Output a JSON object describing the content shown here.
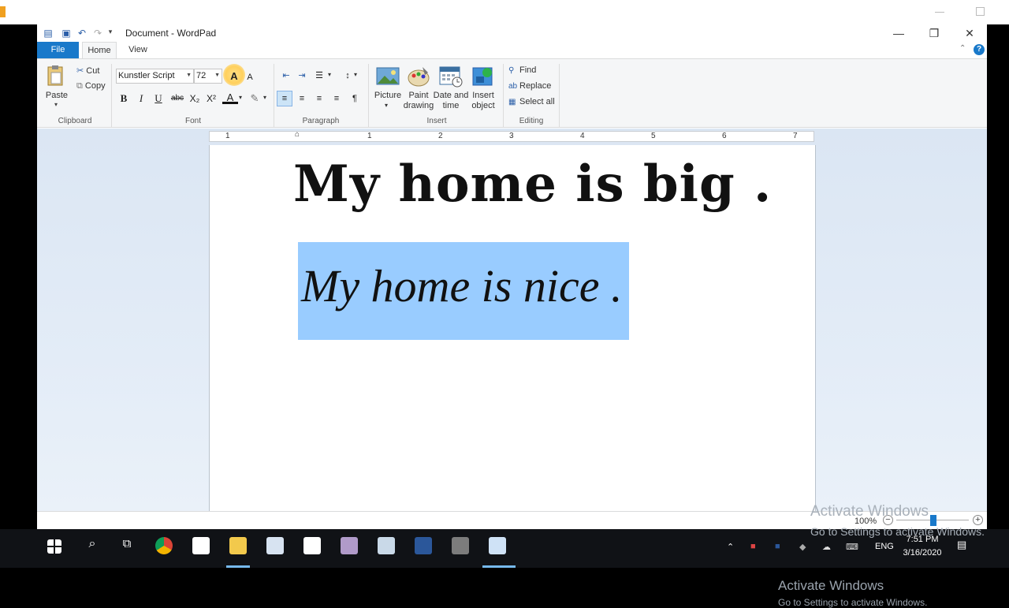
{
  "window": {
    "title": "Document - WordPad",
    "min_icon": "minimize-icon",
    "max_icon": "restore-icon",
    "close_icon": "close-icon"
  },
  "tabs": {
    "file": "File",
    "home": "Home",
    "view": "View"
  },
  "ribbon": {
    "clipboard": {
      "paste": "Paste",
      "cut": "Cut",
      "copy": "Copy",
      "label": "Clipboard"
    },
    "font": {
      "family": "Kunstler Script",
      "size": "72",
      "label": "Font",
      "grow": "A",
      "shrink": "A",
      "bold": "B",
      "italic": "I",
      "underline": "U",
      "strike": "abc",
      "subscript": "X₂",
      "superscript": "X²",
      "color": "A"
    },
    "paragraph": {
      "label": "Paragraph"
    },
    "insert": {
      "picture": "Picture",
      "paint1": "Paint",
      "paint2": "drawing",
      "date1": "Date and",
      "date2": "time",
      "obj1": "Insert",
      "obj2": "object",
      "label": "Insert"
    },
    "editing": {
      "find": "Find",
      "replace": "Replace",
      "select_all": "Select all",
      "label": "Editing"
    }
  },
  "ruler": [
    "1",
    "1",
    "2",
    "3",
    "4",
    "5",
    "6",
    "7"
  ],
  "document": {
    "line1": "My home is big .",
    "line2": "My home is nice ."
  },
  "watermark": {
    "title": "Activate Windows",
    "subtitle": "Go to Settings to activate Windows."
  },
  "status": {
    "zoom": "100%",
    "minus": "−",
    "plus": "+"
  },
  "taskbar": {
    "lang": "ENG",
    "time": "7:51 PM",
    "date": "3/16/2020"
  },
  "colors": {
    "accent": "#1979ca",
    "selection": "#99ccff",
    "taskbar": "#101216"
  }
}
